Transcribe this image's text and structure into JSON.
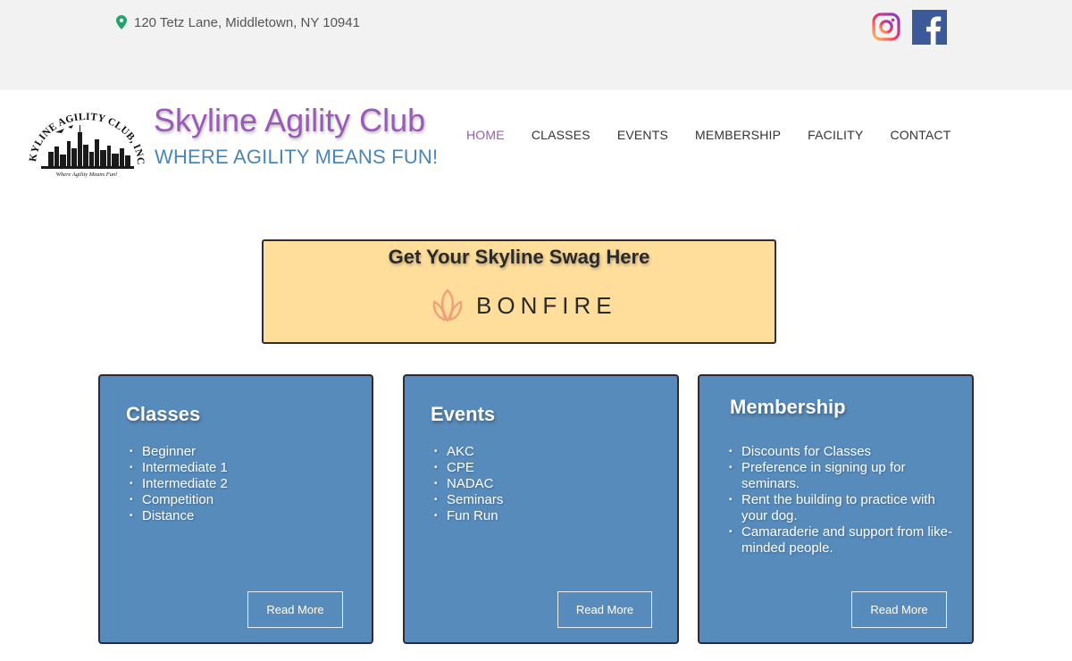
{
  "topbar": {
    "address": "120 Tetz Lane, Middletown, NY 10941",
    "icons": [
      "map-pin-icon",
      "instagram-icon",
      "facebook-icon"
    ]
  },
  "header": {
    "logo_text": "SKYLINE AGILITY CLUB, INC.",
    "logo_caption": "Where Agility Means Fun!",
    "title": "Skyline Agility Club",
    "tagline": "WHERE AGILITY MEANS FUN!"
  },
  "nav": {
    "items": [
      {
        "label": "HOME",
        "active": true
      },
      {
        "label": "CLASSES"
      },
      {
        "label": "EVENTS"
      },
      {
        "label": "MEMBERSHIP"
      },
      {
        "label": "FACILITY"
      },
      {
        "label": "CONTACT"
      }
    ]
  },
  "swag": {
    "title": "Get Your Skyline Swag Here",
    "brand": "BONFIRE"
  },
  "cards": [
    {
      "title": "Classes",
      "items": [
        "Beginner",
        "Intermediate 1",
        "Intermediate 2",
        "Competition",
        "Distance"
      ],
      "button": "Read More"
    },
    {
      "title": "Events",
      "items": [
        "AKC",
        "CPE",
        "NADAC",
        "Seminars",
        "Fun Run"
      ],
      "button": "Read More"
    },
    {
      "title": "Membership",
      "items": [
        "Discounts for Classes",
        "Preference in signing up for seminars.",
        "Rent the building to practice with your dog.",
        "Camaraderie and support from like-minded people."
      ],
      "button": "Read More"
    }
  ],
  "colors": {
    "topbar_bg": "#f2f2f2",
    "title_purple": "#9a5ab5",
    "tagline_blue": "#4a86b8",
    "card_blue": "#578bbb",
    "swag_bg": "#ffde9c",
    "bonfire_orange": "#f2a07b"
  }
}
